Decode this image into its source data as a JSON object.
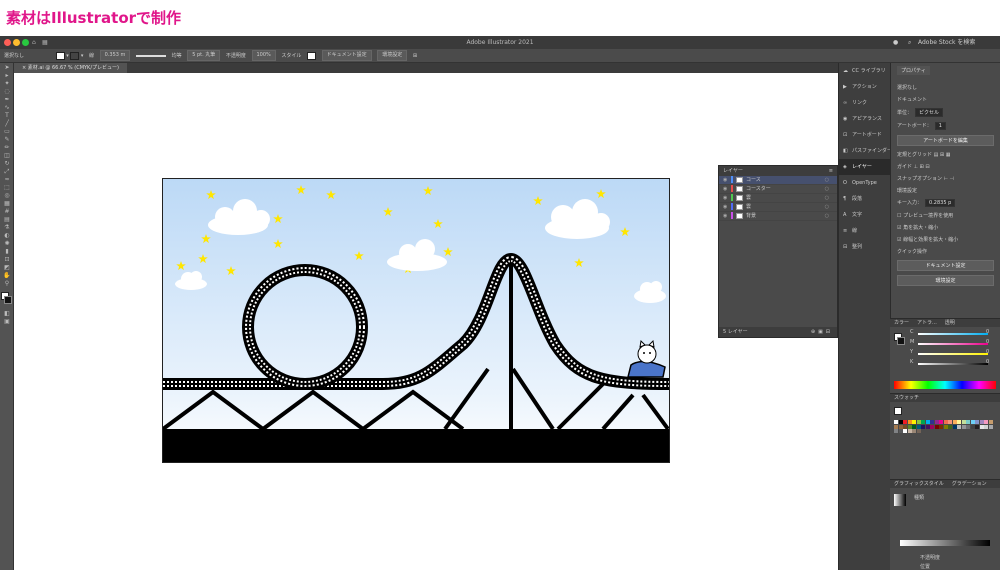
{
  "heading": "素材はIllustratorで制作",
  "app_title": "Adobe Illustrator 2021",
  "search_placeholder": "Adobe Stock を検索",
  "control_bar": {
    "selection": "選択なし",
    "stroke_label": "線",
    "stroke_value": "0.353 m",
    "brush_label": "均等",
    "point": "5 pt. 丸筆",
    "opacity_label": "不透明度",
    "opacity": "100%",
    "style_label": "スタイル",
    "doc_setup": "ドキュメント設定",
    "prefs": "環境設定"
  },
  "doc_tab": "素材.ai @ 66.67 % (CMYK/プレビュー)",
  "icon_strip": [
    {
      "icon": "cc-libraries-icon",
      "label": "CC ライブラリ"
    },
    {
      "icon": "actions-icon",
      "label": "アクション"
    },
    {
      "icon": "links-icon",
      "label": "リンク"
    },
    {
      "icon": "appearance-icon",
      "label": "アピアランス"
    },
    {
      "icon": "artboards-icon",
      "label": "アートボード"
    },
    {
      "icon": "pathfinder-icon",
      "label": "パスファインダー"
    },
    {
      "icon": "layers-icon",
      "label": "レイヤー"
    },
    {
      "icon": "opentype-icon",
      "label": "OpenType"
    },
    {
      "icon": "paragraph-icon",
      "label": "段落"
    },
    {
      "icon": "character-icon",
      "label": "文字"
    },
    {
      "icon": "stroke-icon",
      "label": "線"
    },
    {
      "icon": "align-icon",
      "label": "整列"
    }
  ],
  "properties": {
    "tab": "プロパティ",
    "no_selection": "選択なし",
    "document_section": "ドキュメント",
    "unit_label": "単位：",
    "unit_value": "ピクセル",
    "artboard_label": "アートボード：",
    "artboard_value": "1",
    "edit_artboard_btn": "アートボードを編集",
    "ruler_grid": "定規とグリッド",
    "guide": "ガイド",
    "snap": "スナップオプション",
    "env_section": "環境設定",
    "key_input_label": "キー入力：",
    "key_input_value": "0.2835 p",
    "preview_bounds": "プレビュー境界を使用",
    "scale_corners": "角を拡大・縮小",
    "scale_strokes": "線幅と効果を拡大・縮小",
    "quick_actions": "クイック操作",
    "doc_setup_btn": "ドキュメント設定",
    "prefs_btn": "環境設定"
  },
  "layers": {
    "tab": "レイヤー",
    "items": [
      "コース",
      "コースター",
      "雲",
      "雲",
      "背景"
    ],
    "footer": "5 レイヤー"
  },
  "color_panel": {
    "tabs": [
      "カラー",
      "アトラ...",
      "透明"
    ],
    "channels": [
      "C",
      "M",
      "Y",
      "K"
    ],
    "values": [
      "0",
      "0",
      "0",
      "0"
    ],
    "unit": "%"
  },
  "swatches_title": "スウォッチ",
  "gradient_panel": {
    "tabs": [
      "グラフィックスタイル",
      "グラデーション"
    ],
    "type_label": "種類",
    "opacity_label": "不透明度",
    "location_label": "位置"
  }
}
